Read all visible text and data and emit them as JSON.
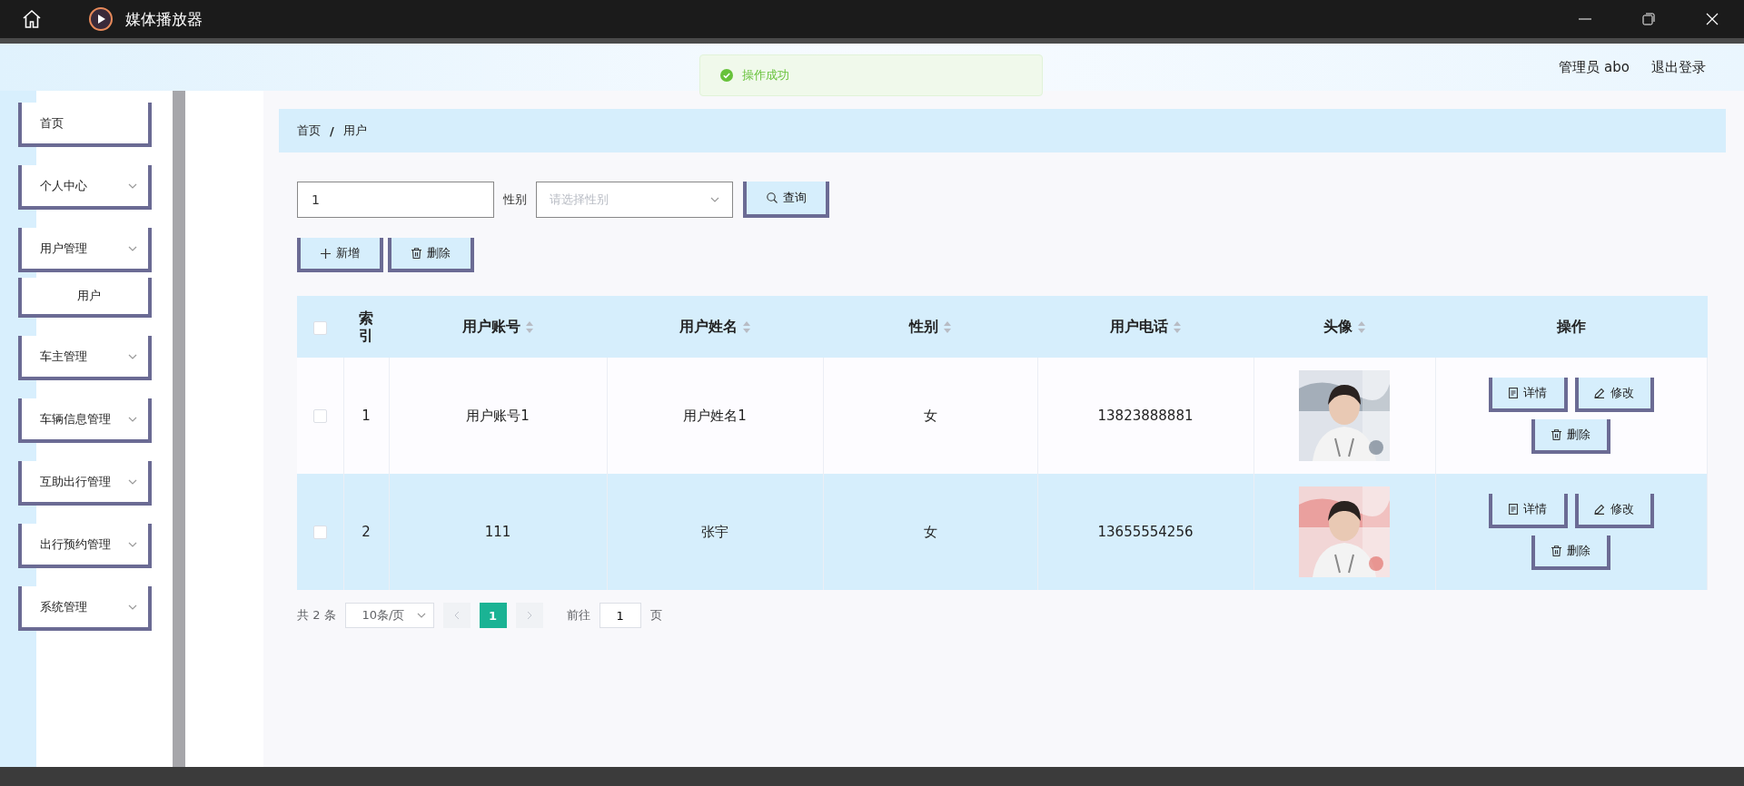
{
  "window": {
    "title": "媒体播放器"
  },
  "header": {
    "user": "管理员 abo",
    "logout": "退出登录"
  },
  "toast": {
    "message": "操作成功",
    "kind": "success"
  },
  "sidebar": {
    "items": [
      {
        "label": "首页",
        "kind": "link"
      },
      {
        "label": "个人中心",
        "kind": "menu"
      },
      {
        "label": "用户管理",
        "kind": "menu",
        "children": [
          {
            "label": "用户"
          }
        ]
      },
      {
        "label": "车主管理",
        "kind": "menu"
      },
      {
        "label": "车辆信息管理",
        "kind": "menu"
      },
      {
        "label": "互助出行管理",
        "kind": "menu"
      },
      {
        "label": "出行预约管理",
        "kind": "menu"
      },
      {
        "label": "系统管理",
        "kind": "menu"
      }
    ]
  },
  "breadcrumb": {
    "separator": "/",
    "items": [
      "首页",
      "用户"
    ]
  },
  "filters": {
    "search_value": "1",
    "gender_label": "性别",
    "gender_placeholder": "请选择性别",
    "query_button": "查询"
  },
  "actions": [
    {
      "label": "新增",
      "kind": "add"
    },
    {
      "label": "删除",
      "kind": "delete"
    }
  ],
  "table": {
    "select_all_checked": false,
    "columns": [
      {
        "label": "索引",
        "sortable": false
      },
      {
        "label": "用户账号",
        "sortable": true
      },
      {
        "label": "用户姓名",
        "sortable": true
      },
      {
        "label": "性别",
        "sortable": true
      },
      {
        "label": "用户电话",
        "sortable": true
      },
      {
        "label": "头像",
        "sortable": true
      },
      {
        "label": "操作",
        "sortable": false
      }
    ],
    "rows": [
      {
        "checked": false,
        "highlighted": false,
        "index": "1",
        "account": "用户账号1",
        "name": "用户姓名1",
        "gender": "女",
        "phone": "13823888881",
        "actions": [
          {
            "label": "详情",
            "kind": "detail"
          },
          {
            "label": "修改",
            "kind": "edit"
          },
          {
            "label": "删除",
            "kind": "delete"
          }
        ]
      },
      {
        "checked": false,
        "highlighted": true,
        "index": "2",
        "account": "111",
        "name": "张宇",
        "gender": "女",
        "phone": "13655554256",
        "actions": [
          {
            "label": "详情",
            "kind": "detail"
          },
          {
            "label": "修改",
            "kind": "edit"
          },
          {
            "label": "删除",
            "kind": "delete"
          }
        ]
      }
    ]
  },
  "pagination": {
    "total": "共 2 条",
    "page_size": "10条/页",
    "pages": [
      {
        "label": "1",
        "selected": true
      }
    ],
    "goto_label": "前往",
    "goto_value": "1",
    "page_suffix": "页"
  }
}
